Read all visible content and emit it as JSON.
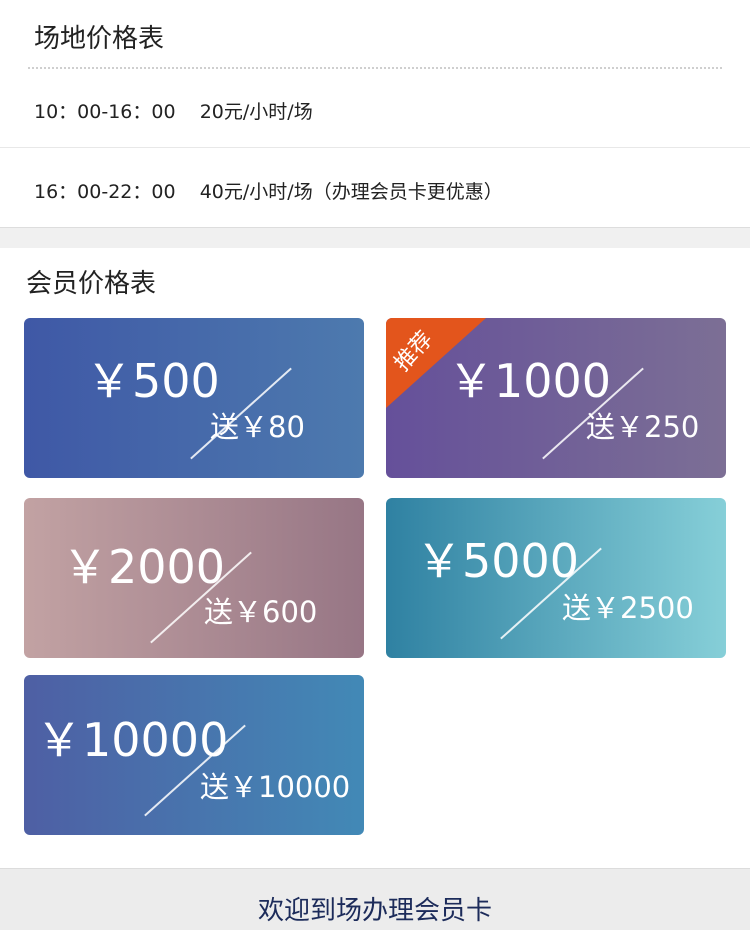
{
  "venue": {
    "title": "场地价格表",
    "rows": [
      "10：00-16：00    20元/小时/场",
      "16：00-22：00    40元/小时/场（办理会员卡更优惠）"
    ]
  },
  "member": {
    "title": "会员价格表",
    "cards": [
      {
        "amount": "￥500",
        "bonus": "送￥80"
      },
      {
        "amount": "￥1000",
        "bonus": "送￥250",
        "badge": "推荐"
      },
      {
        "amount": "￥2000",
        "bonus": "送￥600"
      },
      {
        "amount": "￥5000",
        "bonus": "送￥2500"
      },
      {
        "amount": "￥10000",
        "bonus": "送￥10000"
      }
    ]
  },
  "footer": {
    "button_label": "欢迎到场办理会员卡"
  },
  "colors": {
    "badge": "#e3551c",
    "footer_text": "#1c2b5a"
  }
}
